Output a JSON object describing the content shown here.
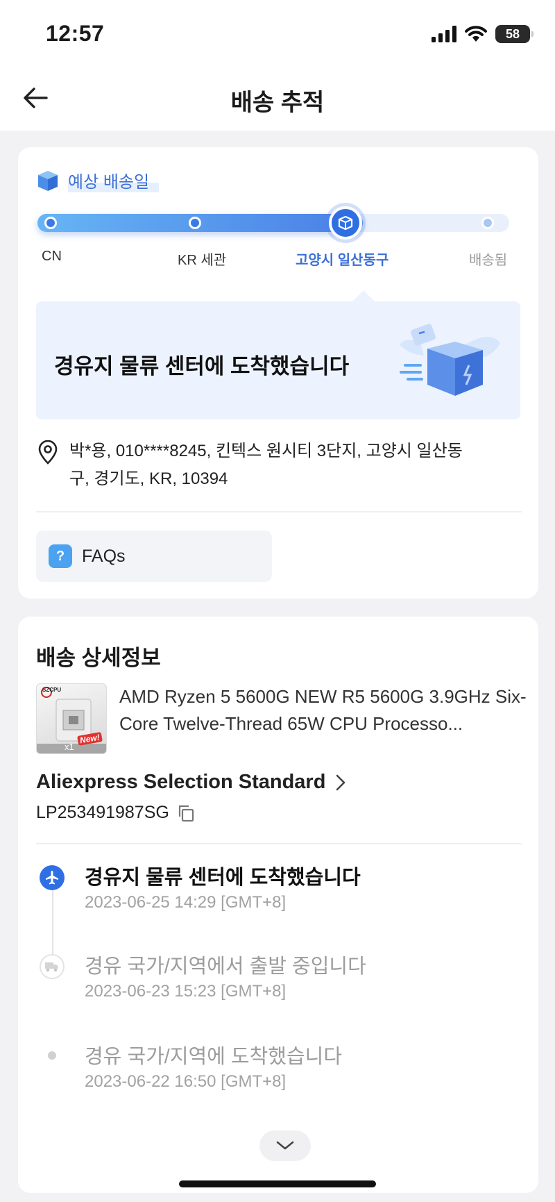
{
  "status_bar": {
    "time": "12:57",
    "battery": "58"
  },
  "header": {
    "title": "배송 추적"
  },
  "tracking": {
    "estimated_label": "예상 배송일",
    "progress_fraction": 0.69,
    "steps": [
      {
        "label": "CN",
        "state": "done"
      },
      {
        "label": "KR 세관",
        "state": "done"
      },
      {
        "label": "고양시 일산동구",
        "state": "current"
      },
      {
        "label": "배송됨",
        "state": "pending"
      }
    ],
    "status_message": "경유지 물류 센터에 도착했습니다",
    "address_line1": "박*용,  010****8245,  킨텍스 원시티 3단지,  고양시 일산동",
    "address_line2": "구,  경기도,  KR,  10394",
    "faq_label": "FAQs"
  },
  "details": {
    "title": "배송 상세정보",
    "product_name": "AMD Ryzen 5 5600G NEW R5 5600G 3.9GHz Six-Core Twelve-Thread 65W CPU Processo...",
    "thumb_brand": "SZCPU",
    "thumb_badge": "New!",
    "thumb_qty": "x1",
    "carrier": "Aliexpress Selection Standard",
    "tracking_number": "LP253491987SG",
    "events": [
      {
        "title": "경유지 물류 센터에 도착했습니다",
        "time": "2023-06-25 14:29 [GMT+8]",
        "icon": "airplane-icon",
        "active": true
      },
      {
        "title": "경유 국가/지역에서 출발 중입니다",
        "time": "2023-06-23 15:23 [GMT+8]",
        "icon": "truck-icon",
        "active": false
      },
      {
        "title": "경유 국가/지역에 도착했습니다",
        "time": "2023-06-22 16:50 [GMT+8]",
        "icon": "dot-icon",
        "active": false
      }
    ]
  },
  "colors": {
    "accent": "#3a6fd8",
    "progress_start": "#66b5f5",
    "progress_end": "#4a7fe6",
    "banner_bg": "#ecf3fe"
  }
}
